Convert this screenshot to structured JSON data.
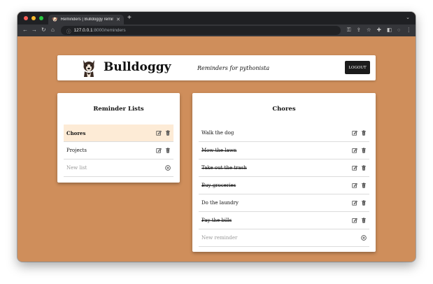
{
  "browser": {
    "tab_title": "Reminders | Bulldoggy reminder",
    "url_host": "127.0.0.1",
    "url_rest": ":8000/reminders"
  },
  "header": {
    "brand": "Bulldoggy",
    "tagline": "Reminders for pythonista",
    "logout_label": "LOGOUT"
  },
  "lists_panel": {
    "title": "Reminder Lists",
    "items": [
      {
        "label": "Chores",
        "selected": true
      },
      {
        "label": "Projects",
        "selected": false
      }
    ],
    "new_placeholder": "New list"
  },
  "items_panel": {
    "title": "Chores",
    "items": [
      {
        "label": "Walk the dog",
        "completed": false
      },
      {
        "label": "Mow the lawn",
        "completed": true
      },
      {
        "label": "Take out the trash",
        "completed": true
      },
      {
        "label": "Buy groceries",
        "completed": true
      },
      {
        "label": "Do the laundry",
        "completed": false
      },
      {
        "label": "Pay the bills",
        "completed": true
      }
    ],
    "new_placeholder": "New reminder"
  },
  "colors": {
    "page_background": "#cf8e5b",
    "selected_row": "#fdebd6",
    "logout_button": "#1b1b1b"
  }
}
